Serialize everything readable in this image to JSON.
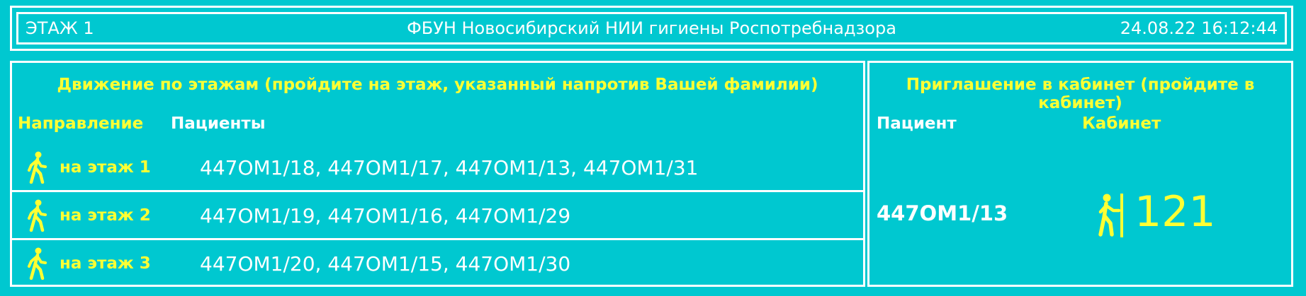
{
  "header": {
    "floor": "ЭТАЖ 1",
    "org": "ФБУН Новосибирский НИИ гигиены Роспотребнадзора",
    "datetime": "24.08.22 16:12:44"
  },
  "movement": {
    "title": "Движение по этажам (пройдите на этаж, указанный напротив Вашей фамилии)",
    "col_direction": "Направление",
    "col_patients": "Пациенты",
    "rows": [
      {
        "icon": "walking-person-icon",
        "floor": "на этаж 1",
        "patients": "447ОМ1/18, 447ОМ1/17, 447ОМ1/13, 447ОМ1/31"
      },
      {
        "icon": "walking-person-icon",
        "floor": "на этаж 2",
        "patients": "447ОМ1/19, 447ОМ1/16, 447ОМ1/29"
      },
      {
        "icon": "walking-person-icon",
        "floor": "на этаж 3",
        "patients": "447ОМ1/20, 447ОМ1/15, 447ОМ1/30"
      }
    ]
  },
  "invitation": {
    "title": "Приглашение в кабинет (пройдите в кабинет)",
    "col_patient": "Пациент",
    "col_cabinet": "Кабинет",
    "patient": "447ОМ1/13",
    "cabinet": "121",
    "icon": "person-entering-door-icon"
  },
  "colors": {
    "background": "#00c8d0",
    "accent": "#ffff33",
    "border": "#ffffff"
  }
}
